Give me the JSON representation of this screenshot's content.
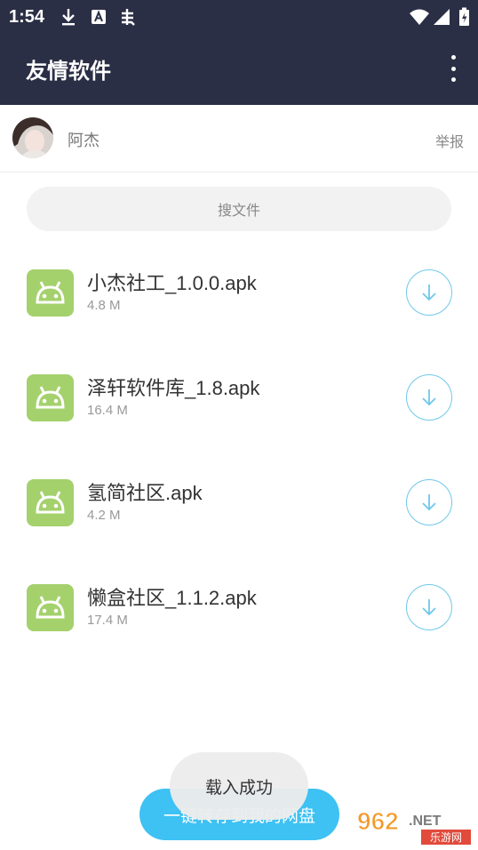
{
  "status_bar": {
    "time": "1:54"
  },
  "app_bar": {
    "title": "友情软件"
  },
  "user": {
    "name": "阿杰",
    "report_label": "举报"
  },
  "search": {
    "placeholder": "搜文件"
  },
  "files": [
    {
      "name": "小杰社工_1.0.0.apk",
      "size": "4.8 M"
    },
    {
      "name": "泽轩软件库_1.8.apk",
      "size": "16.4 M"
    },
    {
      "name": "氢简社区.apk",
      "size": "4.2 M"
    },
    {
      "name": "懒盒社区_1.1.2.apk",
      "size": "17.4 M"
    }
  ],
  "save_button": {
    "label": "一键转存到我的网盘"
  },
  "toast": {
    "text": "载入成功"
  },
  "watermark": {
    "number": "962",
    "suffix": ".NET",
    "site": "乐游网"
  },
  "colors": {
    "app_bar": "#2b2f45",
    "accent": "#3ec1f3",
    "apk_icon": "#a4d16c",
    "download_ring": "#6ec8ea"
  },
  "icons": [
    "download-icon",
    "a-icon",
    "bug-icon",
    "wifi-icon",
    "signal-icon",
    "battery-icon",
    "more-vert-icon",
    "android-icon",
    "arrow-down-icon"
  ]
}
